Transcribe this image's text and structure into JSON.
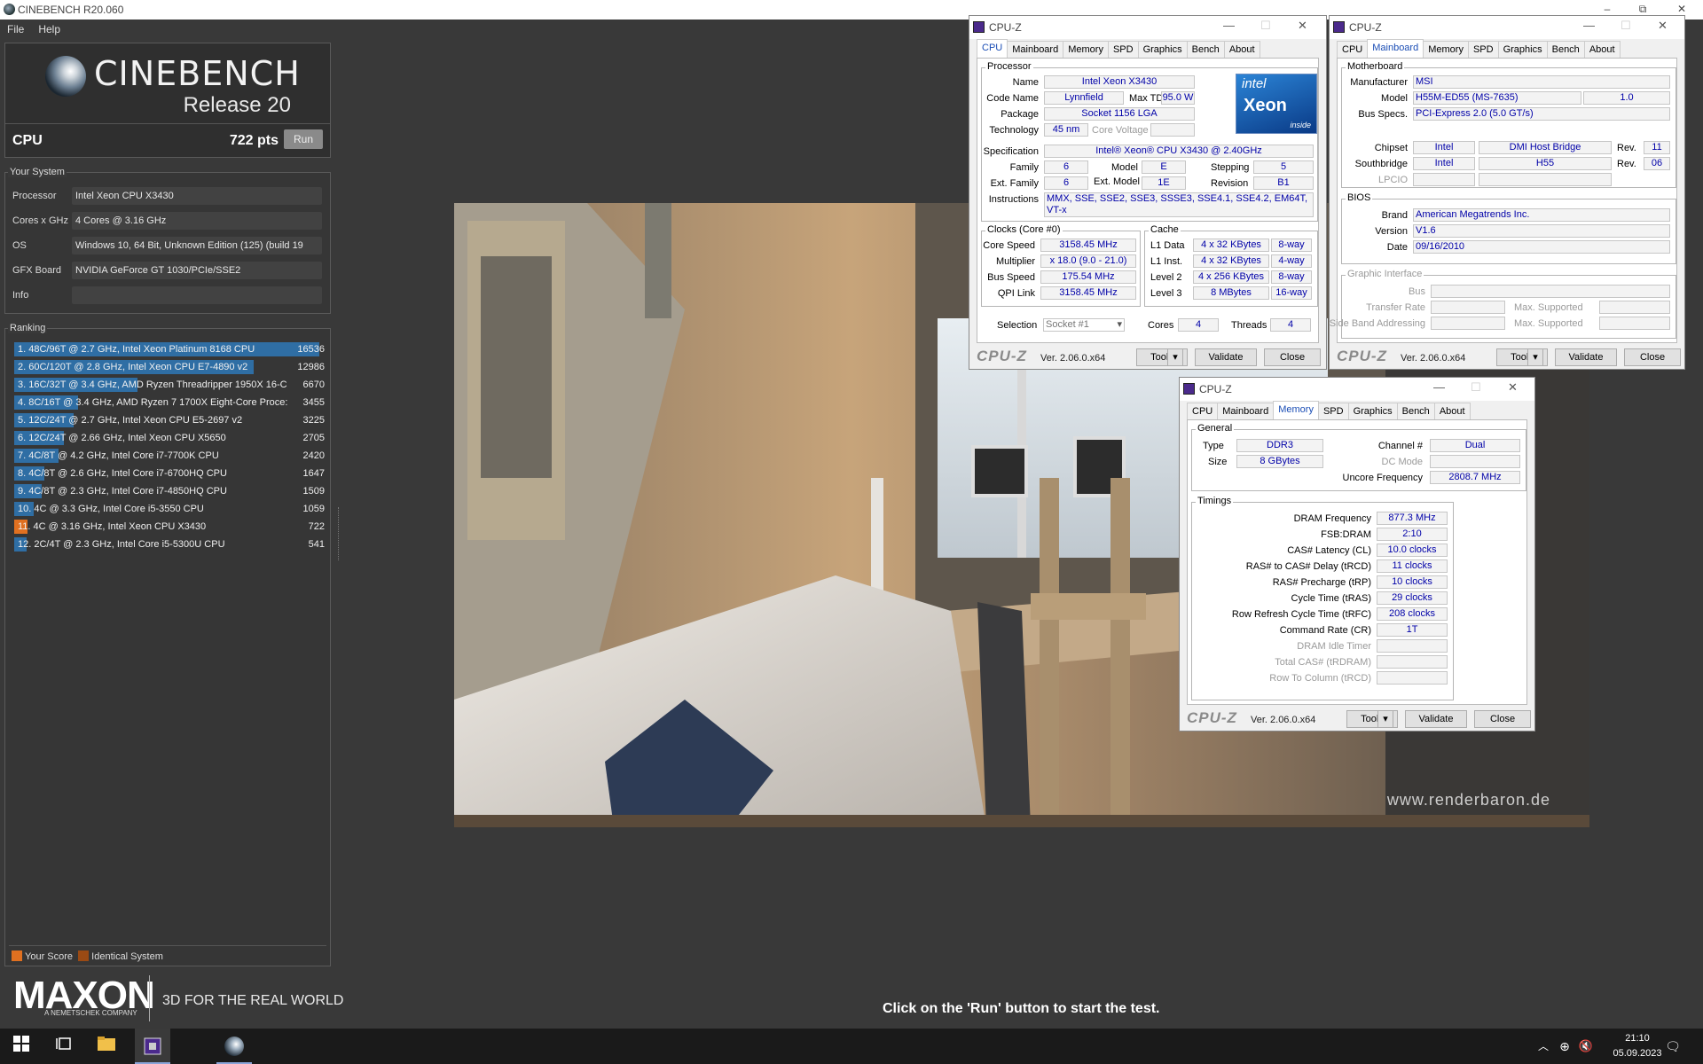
{
  "window": {
    "title": "CINEBENCH R20.060",
    "minimize": "–",
    "maximize": "⧉",
    "close": "✕"
  },
  "menu": [
    "File",
    "Help"
  ],
  "logo": {
    "name": "CINEBENCH",
    "release": "Release 20"
  },
  "cpu": {
    "label": "CPU",
    "score": "722 pts",
    "run": "Run"
  },
  "system": {
    "title": "Your System",
    "rows": [
      {
        "k": "Processor",
        "v": "Intel Xeon CPU X3430"
      },
      {
        "k": "Cores x GHz",
        "v": "4 Cores @ 3.16 GHz"
      },
      {
        "k": "OS",
        "v": "Windows 10, 64 Bit, Unknown Edition (125) (build 19"
      },
      {
        "k": "GFX Board",
        "v": "NVIDIA GeForce GT 1030/PCIe/SSE2"
      },
      {
        "k": "Info",
        "v": ""
      }
    ]
  },
  "ranking": {
    "title": "Ranking",
    "max": 16536,
    "rows": [
      {
        "t": "1. 48C/96T @ 2.7 GHz, Intel Xeon Platinum 8168 CPU",
        "s": "16536",
        "v": 16536,
        "c": "#2f6ea4"
      },
      {
        "t": "2. 60C/120T @ 2.8 GHz, Intel Xeon CPU E7-4890 v2",
        "s": "12986",
        "v": 12986,
        "c": "#2f6ea4"
      },
      {
        "t": "3. 16C/32T @ 3.4 GHz, AMD Ryzen Threadripper 1950X 16-C",
        "s": "6670",
        "v": 6670,
        "c": "#2f6ea4"
      },
      {
        "t": "4. 8C/16T @ 3.4 GHz, AMD Ryzen 7 1700X Eight-Core Proce:",
        "s": "3455",
        "v": 3455,
        "c": "#2f6ea4"
      },
      {
        "t": "5. 12C/24T @ 2.7 GHz, Intel Xeon CPU E5-2697 v2",
        "s": "3225",
        "v": 3225,
        "c": "#2f6ea4"
      },
      {
        "t": "6. 12C/24T @ 2.66 GHz, Intel Xeon CPU X5650",
        "s": "2705",
        "v": 2705,
        "c": "#2f6ea4"
      },
      {
        "t": "7. 4C/8T @ 4.2 GHz, Intel Core i7-7700K CPU",
        "s": "2420",
        "v": 2420,
        "c": "#2f6ea4"
      },
      {
        "t": "8. 4C/8T @ 2.6 GHz, Intel Core i7-6700HQ CPU",
        "s": "1647",
        "v": 1647,
        "c": "#2f6ea4"
      },
      {
        "t": "9. 4C/8T @ 2.3 GHz, Intel Core i7-4850HQ CPU",
        "s": "1509",
        "v": 1509,
        "c": "#2f6ea4"
      },
      {
        "t": "10. 4C @ 3.3 GHz, Intel Core i5-3550 CPU",
        "s": "1059",
        "v": 1059,
        "c": "#2f6ea4"
      },
      {
        "t": "11. 4C @ 3.16 GHz, Intel Xeon CPU X3430",
        "s": "722",
        "v": 722,
        "c": "#e07020"
      },
      {
        "t": "12. 2C/4T @ 2.3 GHz, Intel Core i5-5300U CPU",
        "s": "541",
        "v": 541,
        "c": "#2f6ea4"
      }
    ]
  },
  "legend": {
    "your": "Your Score",
    "identical": "Identical System",
    "your_color": "#e07020",
    "identical_color": "#9a4a14"
  },
  "brand": {
    "name": "MAXON",
    "sub": "A NEMETSCHEK COMPANY",
    "tagline": "3D FOR THE REAL WORLD"
  },
  "status": "Click on the 'Run' button to start the test.",
  "watermark": "www.renderbaron.de",
  "cpuz_common": {
    "title": "CPU-Z",
    "logo": "CPU-Z",
    "version": "Ver. 2.06.0.x64",
    "tools": "Tools",
    "validate": "Validate",
    "close": "Close",
    "tabs": [
      "CPU",
      "Mainboard",
      "Memory",
      "SPD",
      "Graphics",
      "Bench",
      "About"
    ]
  },
  "cpuz_cpu": {
    "processor_group": "Processor",
    "name_l": "Name",
    "name": "Intel Xeon X3430",
    "code_l": "Code Name",
    "code": "Lynnfield",
    "tdp_l": "Max TDP",
    "tdp": "95.0 W",
    "pkg_l": "Package",
    "pkg": "Socket 1156 LGA",
    "tech_l": "Technology",
    "tech": "45 nm",
    "volt_l": "Core Voltage",
    "spec_l": "Specification",
    "spec": "Intel® Xeon® CPU         X3430  @ 2.40GHz",
    "fam_l": "Family",
    "fam": "6",
    "model_l": "Model",
    "model": "E",
    "step_l": "Stepping",
    "step": "5",
    "efam_l": "Ext. Family",
    "efam": "6",
    "emodel_l": "Ext. Model",
    "emodel": "1E",
    "rev_l": "Revision",
    "rev": "B1",
    "inst_l": "Instructions",
    "inst": "MMX, SSE, SSE2, SSE3, SSSE3, SSE4.1, SSE4.2, EM64T, VT-x",
    "clocks_group": "Clocks (Core #0)",
    "cs_l": "Core Speed",
    "cs": "3158.45 MHz",
    "mul_l": "Multiplier",
    "mul": "x 18.0 (9.0 - 21.0)",
    "bus_l": "Bus Speed",
    "bus": "175.54 MHz",
    "qpi_l": "QPI Link",
    "qpi": "3158.45 MHz",
    "cache_group": "Cache",
    "l1d_l": "L1 Data",
    "l1d": "4 x 32 KBytes",
    "l1d_w": "8-way",
    "l1i_l": "L1 Inst.",
    "l1i": "4 x 32 KBytes",
    "l1i_w": "4-way",
    "l2_l": "Level 2",
    "l2": "4 x 256 KBytes",
    "l2_w": "8-way",
    "l3_l": "Level 3",
    "l3": "8 MBytes",
    "l3_w": "16-way",
    "sel_l": "Selection",
    "sel": "Socket #1",
    "cores_l": "Cores",
    "cores": "4",
    "threads_l": "Threads",
    "threads": "4",
    "intel_word": "intel",
    "xeon_word": "Xeon",
    "inside_word": "inside"
  },
  "cpuz_mb": {
    "mb_group": "Motherboard",
    "man_l": "Manufacturer",
    "man": "MSI",
    "model_l": "Model",
    "model": "H55M-ED55 (MS-7635)",
    "model_rev": "1.0",
    "bus_l": "Bus Specs.",
    "bus": "PCI-Express 2.0 (5.0 GT/s)",
    "chip_l": "Chipset",
    "chip": "Intel",
    "chip2": "DMI Host Bridge",
    "rev_l": "Rev.",
    "chip_rev": "11",
    "sb_l": "Southbridge",
    "sb": "Intel",
    "sb2": "H55",
    "sb_rev": "06",
    "lpcio_l": "LPCIO",
    "bios_group": "BIOS",
    "brand_l": "Brand",
    "brand": "American Megatrends Inc.",
    "ver_l": "Version",
    "ver": "V1.6",
    "date_l": "Date",
    "date": "09/16/2010",
    "gi_group": "Graphic Interface",
    "gbus_l": "Bus",
    "tr_l": "Transfer Rate",
    "ms_l": "Max. Supported",
    "sba_l": "Side Band Addressing"
  },
  "cpuz_mem": {
    "gen_group": "General",
    "type_l": "Type",
    "type": "DDR3",
    "ch_l": "Channel #",
    "ch": "Dual",
    "size_l": "Size",
    "size": "8 GBytes",
    "dc_l": "DC Mode",
    "unc_l": "Uncore Frequency",
    "unc": "2808.7 MHz",
    "tim_group": "Timings",
    "rows": [
      {
        "k": "DRAM Frequency",
        "v": "877.3 MHz",
        "d": false
      },
      {
        "k": "FSB:DRAM",
        "v": "2:10",
        "d": false
      },
      {
        "k": "CAS# Latency (CL)",
        "v": "10.0 clocks",
        "d": false
      },
      {
        "k": "RAS# to CAS# Delay (tRCD)",
        "v": "11 clocks",
        "d": false
      },
      {
        "k": "RAS# Precharge (tRP)",
        "v": "10 clocks",
        "d": false
      },
      {
        "k": "Cycle Time (tRAS)",
        "v": "29 clocks",
        "d": false
      },
      {
        "k": "Row Refresh Cycle Time (tRFC)",
        "v": "208 clocks",
        "d": false
      },
      {
        "k": "Command Rate (CR)",
        "v": "1T",
        "d": false
      },
      {
        "k": "DRAM Idle Timer",
        "v": "",
        "d": true
      },
      {
        "k": "Total CAS# (tRDRAM)",
        "v": "",
        "d": true
      },
      {
        "k": "Row To Column (tRCD)",
        "v": "",
        "d": true
      }
    ]
  },
  "taskbar": {
    "time": "21:10",
    "date": "05.09.2023",
    "start_icon": "windows-icon",
    "tray": [
      "chevron-up-icon",
      "globe-icon",
      "speaker-mute-icon"
    ]
  }
}
